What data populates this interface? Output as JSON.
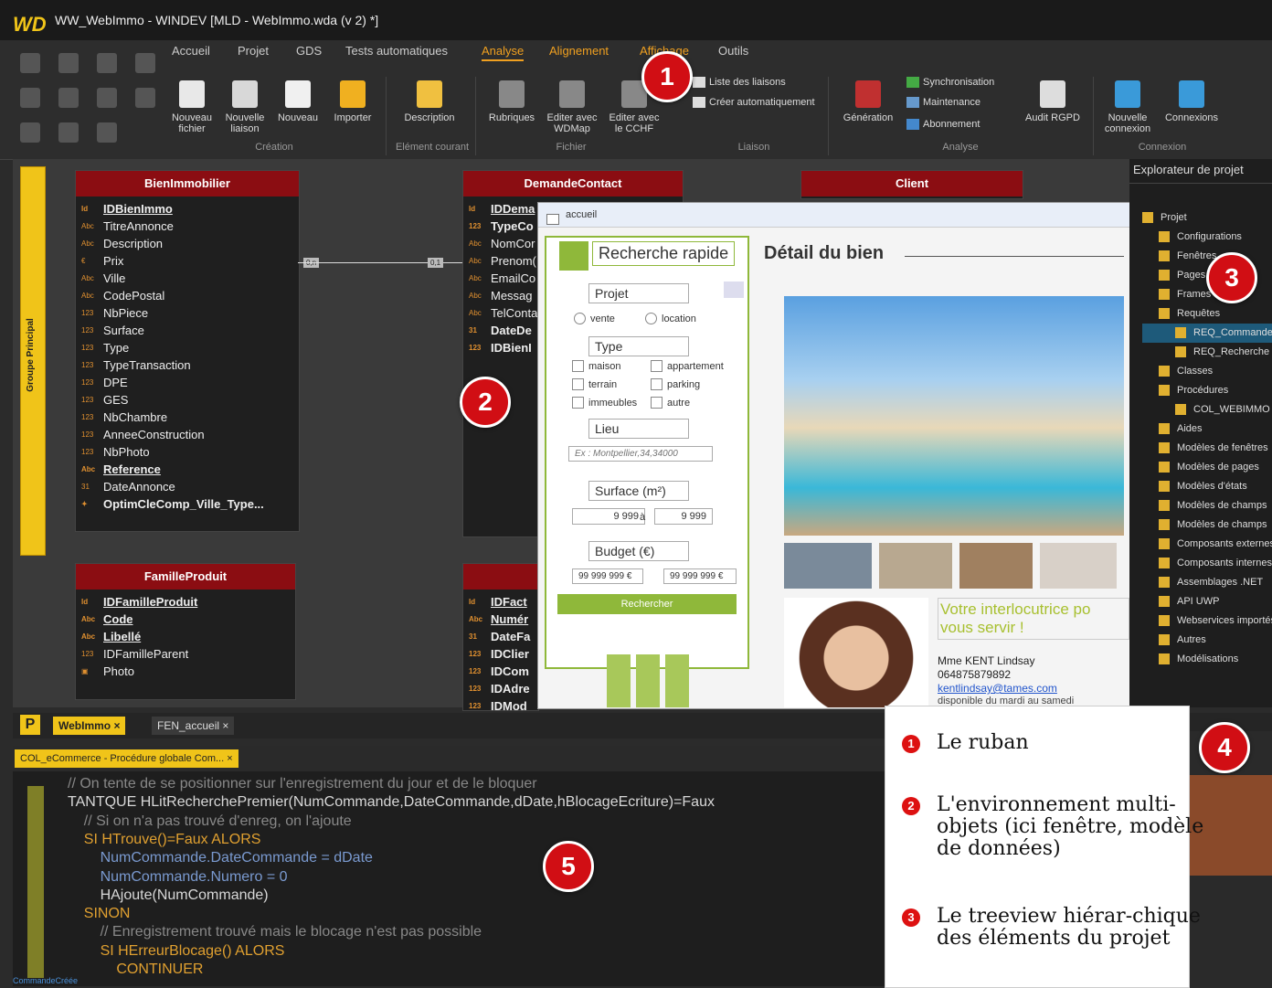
{
  "app": {
    "logo": "WD",
    "title": "WW_WebImmo - WINDEV   [MLD - WebImmo.wda (v 2) *]"
  },
  "ribbon": {
    "tabs": [
      "Accueil",
      "Projet",
      "GDS",
      "Tests automatiques",
      "Analyse",
      "Alignement",
      "Affichage",
      "Outils"
    ],
    "active_tab": "Analyse",
    "buttons": {
      "nouveau_fichier": "Nouveau fichier",
      "nouvelle_liaison": "Nouvelle liaison",
      "nouveau": "Nouveau",
      "importer": "Importer",
      "description": "Description",
      "rubriques": "Rubriques",
      "editer_wdmap": "Editer avec WDMap",
      "editer_cchf": "Editer avec le CCHF",
      "liste_liaisons": "Liste des liaisons",
      "creer_auto": "Créer automatiquement",
      "generation": "Génération",
      "synchronisation": "Synchronisation",
      "maintenance": "Maintenance",
      "abonnement": "Abonnement",
      "audit": "Audit RGPD",
      "nouvelle_connexion": "Nouvelle connexion",
      "connexions": "Connexions"
    },
    "groups": {
      "creation": "Création",
      "element_courant": "Elément courant",
      "fichier": "Fichier",
      "liaison": "Liaison",
      "analyse": "Analyse",
      "connexion": "Connexion"
    }
  },
  "sidetab": "Groupe Principal",
  "tables": {
    "bien": {
      "title": "BienImmobilier",
      "fields": [
        {
          "t": "Id",
          "n": "IDBienImmo",
          "s": "key"
        },
        {
          "t": "Abc",
          "n": "TitreAnnonce",
          "s": ""
        },
        {
          "t": "Abc",
          "n": "Description",
          "s": ""
        },
        {
          "t": "€",
          "n": "Prix",
          "s": ""
        },
        {
          "t": "Abc",
          "n": "Ville",
          "s": ""
        },
        {
          "t": "Abc",
          "n": "CodePostal",
          "s": ""
        },
        {
          "t": "123",
          "n": "NbPiece",
          "s": ""
        },
        {
          "t": "123",
          "n": "Surface",
          "s": ""
        },
        {
          "t": "123",
          "n": "Type",
          "s": ""
        },
        {
          "t": "123",
          "n": "TypeTransaction",
          "s": ""
        },
        {
          "t": "123",
          "n": "DPE",
          "s": ""
        },
        {
          "t": "123",
          "n": "GES",
          "s": ""
        },
        {
          "t": "123",
          "n": "NbChambre",
          "s": ""
        },
        {
          "t": "123",
          "n": "AnneeConstruction",
          "s": ""
        },
        {
          "t": "123",
          "n": "NbPhoto",
          "s": ""
        },
        {
          "t": "Abc",
          "n": "Reference",
          "s": "key"
        },
        {
          "t": "31",
          "n": "DateAnnonce",
          "s": ""
        },
        {
          "t": "✦",
          "n": "OptimCleComp_Ville_Type...",
          "s": "bold"
        }
      ]
    },
    "demande": {
      "title": "DemandeContact",
      "fields": [
        {
          "t": "Id",
          "n": "IDDema",
          "s": "key"
        },
        {
          "t": "123",
          "n": "TypeCo",
          "s": "bold"
        },
        {
          "t": "Abc",
          "n": "NomCor",
          "s": ""
        },
        {
          "t": "Abc",
          "n": "Prenom(",
          "s": ""
        },
        {
          "t": "Abc",
          "n": "EmailCo",
          "s": ""
        },
        {
          "t": "Abc",
          "n": "Messag",
          "s": ""
        },
        {
          "t": "Abc",
          "n": "TelConta",
          "s": ""
        },
        {
          "t": "31",
          "n": "DateDe",
          "s": "bold"
        },
        {
          "t": "123",
          "n": "IDBienI",
          "s": "bold"
        }
      ]
    },
    "client": {
      "title": "Client"
    },
    "famille": {
      "title": "FamilleProduit",
      "fields": [
        {
          "t": "Id",
          "n": "IDFamilleProduit",
          "s": "key"
        },
        {
          "t": "Abc",
          "n": "Code",
          "s": "key"
        },
        {
          "t": "Abc",
          "n": "Libellé",
          "s": "key"
        },
        {
          "t": "123",
          "n": "IDFamilleParent",
          "s": ""
        },
        {
          "t": "▣",
          "n": "Photo",
          "s": ""
        }
      ]
    },
    "facture": {
      "fields": [
        {
          "t": "Id",
          "n": "IDFact",
          "s": "key"
        },
        {
          "t": "Abc",
          "n": "Numér",
          "s": "key"
        },
        {
          "t": "31",
          "n": "DateFa",
          "s": "bold"
        },
        {
          "t": "123",
          "n": "IDClier",
          "s": "bold"
        },
        {
          "t": "123",
          "n": "IDCom",
          "s": "bold"
        },
        {
          "t": "123",
          "n": "IDAdre",
          "s": "bold"
        },
        {
          "t": "123",
          "n": "IDMod",
          "s": "bold"
        }
      ]
    },
    "rel_left": "0,n",
    "rel_right": "0,1"
  },
  "window": {
    "title": "accueil",
    "search_title": "Recherche rapide",
    "projet": "Projet",
    "vente": "vente",
    "location": "location",
    "type": "Type",
    "types": [
      "maison",
      "appartement",
      "terrain",
      "parking",
      "immeubles",
      "autre"
    ],
    "lieu": "Lieu",
    "lieu_placeholder": "Ex : Montpellier,34,34000",
    "surface": "Surface (m²)",
    "surface_min": "9 999",
    "surface_a": "à",
    "surface_max": "9 999",
    "budget": "Budget (€)",
    "budget_min": "99 999 999 €",
    "budget_max": "99 999 999 €",
    "rechercher": "Rechercher",
    "detail": "Détail du bien",
    "interlocutrice": "Votre interlocutrice po vous servir !",
    "contact_name": "Mme KENT Lindsay",
    "contact_phone": "064875879892",
    "contact_email": "kentlindsay@tames.com",
    "contact_dispo": "disponible du mardi au samedi"
  },
  "explorer": {
    "title": "Explorateur de projet",
    "items": [
      {
        "label": "Projet",
        "indent": 0
      },
      {
        "label": "Configurations",
        "indent": 1
      },
      {
        "label": "Fenêtres",
        "indent": 1
      },
      {
        "label": "Pages",
        "indent": 1
      },
      {
        "label": "Frames",
        "indent": 1
      },
      {
        "label": "Requêtes",
        "indent": 1
      },
      {
        "label": "REQ_Commandes",
        "indent": 2
      },
      {
        "label": "REQ_Recherche",
        "indent": 2
      },
      {
        "label": "Classes",
        "indent": 1
      },
      {
        "label": "Procédures",
        "indent": 1
      },
      {
        "label": "COL_WEBIMMO",
        "indent": 2
      },
      {
        "label": "Aides",
        "indent": 1
      },
      {
        "label": "Modèles de fenêtres",
        "indent": 1
      },
      {
        "label": "Modèles de pages",
        "indent": 1
      },
      {
        "label": "Modèles d'états",
        "indent": 1
      },
      {
        "label": "Modèles de champs",
        "indent": 1
      },
      {
        "label": "Modèles de champs",
        "indent": 1
      },
      {
        "label": "Composants externes",
        "indent": 1
      },
      {
        "label": "Composants internes",
        "indent": 1
      },
      {
        "label": "Assemblages .NET",
        "indent": 1
      },
      {
        "label": "API UWP",
        "indent": 1
      },
      {
        "label": "Webservices importés",
        "indent": 1
      },
      {
        "label": "Autres",
        "indent": 1
      },
      {
        "label": "Modélisations",
        "indent": 1
      }
    ]
  },
  "doc_tabs": [
    "WebImmo",
    "FEN_accueil"
  ],
  "code_tab": "COL_eCommerce - Procédure globale Com...",
  "code_lines": [
    "// On tente de se positionner sur l'enregistrement du jour et de le bloquer",
    "TANTQUE HLitRecherchePremier(NumCommande,DateCommande,dDate,hBlocageEcriture)=Faux",
    "    // Si on n'a pas trouvé d'enreg, on l'ajoute",
    "    SI HTrouve()=Faux ALORS",
    "        NumCommande.DateCommande = dDate",
    "        NumCommande.Numero = 0",
    "        HAjoute(NumCommande)",
    "    SINON",
    "        // Enregistrement trouvé mais le blocage n'est pas possible",
    "        SI HErreurBlocage() ALORS",
    "            CONTINUER"
  ],
  "status": "CommandeCréée",
  "legend": [
    {
      "n": "1",
      "text": "Le ruban"
    },
    {
      "n": "2",
      "text": "L'environnement multi-objets (ici fenêtre, modèle de données)"
    },
    {
      "n": "3",
      "text": "Le treeview hiérar-chique des éléments du projet"
    }
  ],
  "badges": [
    "1",
    "2",
    "3",
    "4",
    "5"
  ],
  "colors": {
    "accent": "#f0a020",
    "table_header": "#8b0d12",
    "badge": "#d10e14",
    "search_border": "#8fb83a"
  }
}
